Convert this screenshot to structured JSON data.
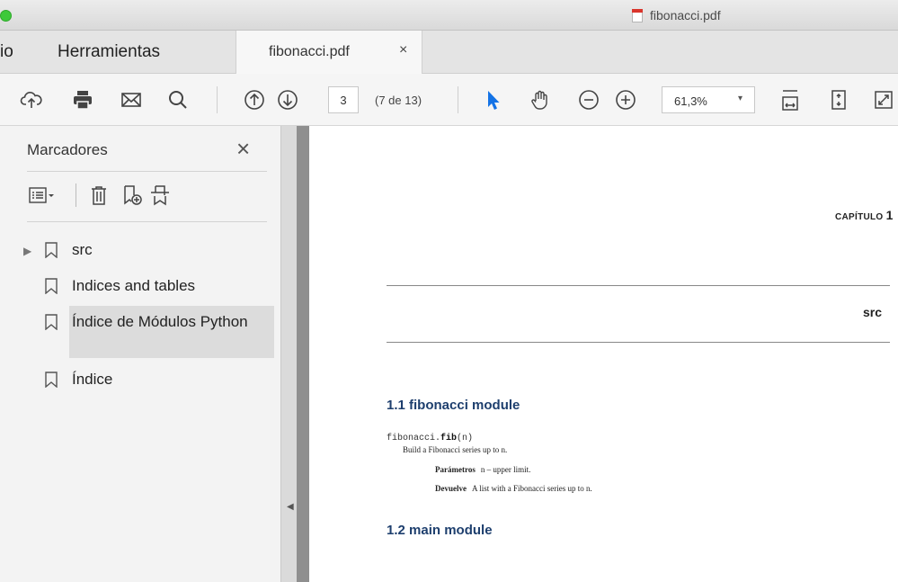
{
  "window": {
    "title": "fibonacci.pdf"
  },
  "tabs": {
    "nav_partial": "io",
    "tools": "Herramientas",
    "doc_tab": "fibonacci.pdf",
    "close_glyph": "×"
  },
  "toolbar": {
    "icons": [
      "upload-cloud-icon",
      "print-icon",
      "mail-icon",
      "search-icon",
      "page-up-icon",
      "page-down-icon",
      "select-arrow-icon",
      "hand-icon",
      "zoom-out-icon",
      "zoom-in-icon",
      "fit-width-icon",
      "fit-page-icon",
      "full-screen-icon"
    ],
    "page_value": "3",
    "page_count": "(7 de 13)",
    "zoom_value": "61,3%",
    "zoom_caret": "▾",
    "accent_color": "#1473e6"
  },
  "sidebar": {
    "title": "Marcadores",
    "close_glyph": "×",
    "tools": [
      "options-menu-icon",
      "delete-icon",
      "new-bookmark-icon",
      "expand-bookmark-icon"
    ],
    "bookmarks": [
      {
        "label": "src",
        "expandable": true,
        "selected": false
      },
      {
        "label": "Indices and tables",
        "expandable": false,
        "selected": false
      },
      {
        "label": "Índice de Módulos Python",
        "expandable": false,
        "selected": true
      },
      {
        "label": "Índice",
        "expandable": false,
        "selected": false
      }
    ],
    "expand_glyph": "▶",
    "collapse_panel_glyph": "◀"
  },
  "document": {
    "chapter_label": "CAPÍTULO",
    "chapter_number": "1",
    "chapter_title": "src",
    "section1": "1.1 fibonacci module",
    "signature_module": "fibonacci.",
    "signature_func": "fib",
    "signature_args": "(n)",
    "description": "Build a Fibonacci series up to n.",
    "param_label": "Parámetros",
    "param_text": "n – upper limit.",
    "returns_label": "Devuelve",
    "returns_text": "A list with a Fibonacci series up to n.",
    "section2": "1.2 main module"
  }
}
